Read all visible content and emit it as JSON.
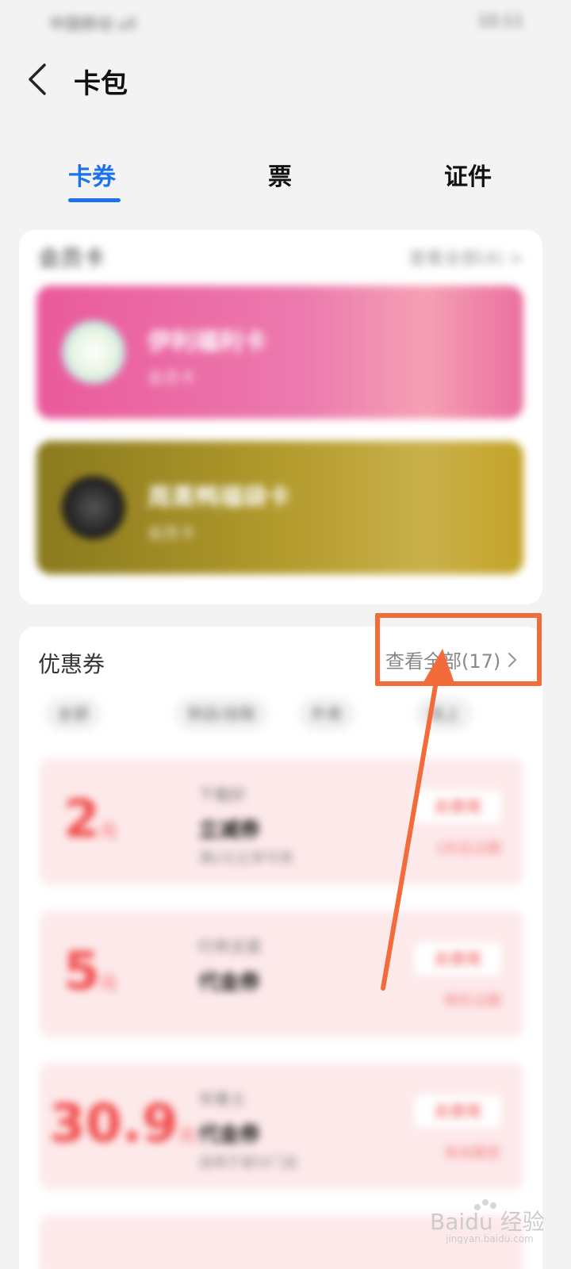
{
  "status_bar": {
    "left_text": "中国移动 ull",
    "right_text": "10:11"
  },
  "header": {
    "title": "卡包"
  },
  "tabs": [
    {
      "label": "卡券",
      "active": true
    },
    {
      "label": "票",
      "active": false
    },
    {
      "label": "证件",
      "active": false
    }
  ],
  "member_section": {
    "title": "会员卡",
    "more": "查看全部(4) >",
    "cards": [
      {
        "name": "伊利福利卡",
        "subtitle": "会员卡"
      },
      {
        "name": "周黑鸭福袋卡",
        "subtitle": "会员卡"
      }
    ]
  },
  "coupon_section": {
    "title": "优惠券",
    "view_all": "查看全部(17)",
    "filters": [
      "全部",
      "到店/自取",
      "外卖",
      "线上"
    ],
    "coupons": [
      {
        "amount": "2",
        "unit": "元",
        "merchant": "下载好",
        "name": "立减券",
        "desc": "满2元立享可用",
        "button": "去使用",
        "expire": "3天后过期"
      },
      {
        "amount": "5",
        "unit": "元",
        "merchant": "叮咚买菜",
        "name": "代金券",
        "desc": "",
        "button": "去使用",
        "expire": "明天过期"
      },
      {
        "amount": "30.9",
        "unit": "元",
        "merchant": "华莱士",
        "name": "代金券",
        "desc": "适用于部分门店",
        "button": "去使用",
        "expire": "有效期至"
      }
    ]
  },
  "annotation": {
    "color": "#f26b3a"
  },
  "watermark": {
    "text": "Baidu 经验",
    "sub": "jingyan.baidu.com"
  },
  "colors": {
    "accent": "#1a73e8",
    "coupon_red": "#f14a4a"
  }
}
